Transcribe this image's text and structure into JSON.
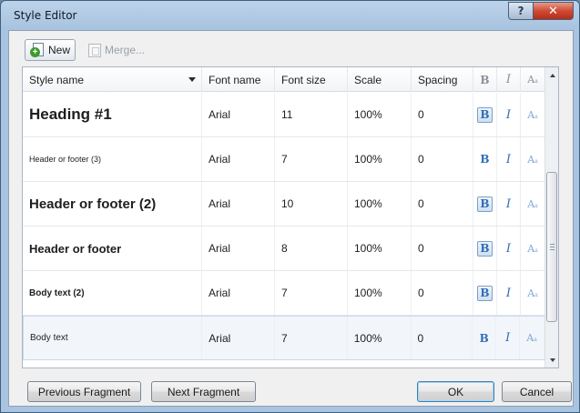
{
  "window": {
    "title": "Style Editor",
    "help_glyph": "?",
    "close_glyph": "✕"
  },
  "toolbar": {
    "new_label": "New",
    "merge_label": "Merge...",
    "new_icon": "new-style-icon",
    "merge_icon": "merge-icon"
  },
  "grid": {
    "columns": {
      "style_name": "Style name",
      "font_name": "Font name",
      "font_size": "Font size",
      "scale": "Scale",
      "spacing": "Spacing",
      "bold": "B",
      "italic": "I",
      "case": "A"
    },
    "rows": [
      {
        "style_name": "Heading #1",
        "font_name": "Arial",
        "font_size": "11",
        "scale": "100%",
        "spacing": "0",
        "bold_on": true
      },
      {
        "style_name": "Header or footer (3)",
        "font_name": "Arial",
        "font_size": "7",
        "scale": "100%",
        "spacing": "0",
        "bold_on": false
      },
      {
        "style_name": "Header or footer (2)",
        "font_name": "Arial",
        "font_size": "10",
        "scale": "100%",
        "spacing": "0",
        "bold_on": true
      },
      {
        "style_name": "Header or footer",
        "font_name": "Arial",
        "font_size": "8",
        "scale": "100%",
        "spacing": "0",
        "bold_on": true
      },
      {
        "style_name": "Body text (2)",
        "font_name": "Arial",
        "font_size": "7",
        "scale": "100%",
        "spacing": "0",
        "bold_on": true
      },
      {
        "style_name": "Body text",
        "font_name": "Arial",
        "font_size": "7",
        "scale": "100%",
        "spacing": "0",
        "bold_on": false
      }
    ]
  },
  "buttons": {
    "previous": "Previous Fragment",
    "next": "Next Fragment",
    "ok": "OK",
    "cancel": "Cancel"
  },
  "colors": {
    "accent": "#2f6db5",
    "title_bar": "#a9c4e0",
    "close_button": "#cf4a34"
  }
}
